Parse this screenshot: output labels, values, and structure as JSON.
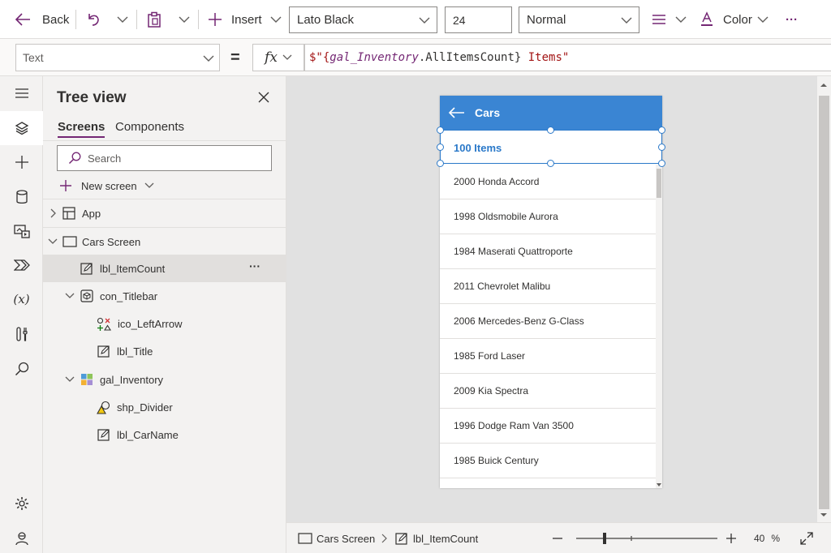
{
  "toolbar": {
    "back_label": "Back",
    "insert_label": "Insert",
    "font_value": "Lato Black",
    "size_value": "24",
    "weight_value": "Normal",
    "color_label": "Color",
    "more_label": "···"
  },
  "formula_bar": {
    "property_value": "Text",
    "equals": "=",
    "fx_label": "fx",
    "tokens": {
      "t1": "$\"{",
      "t2": "gal_Inventory",
      "t3": ".AllItemsCount} ",
      "t4": "Items\""
    }
  },
  "tree": {
    "title": "Tree view",
    "tabs": {
      "screens": "Screens",
      "components": "Components"
    },
    "search_placeholder": "Search",
    "new_screen_label": "New screen",
    "nodes": {
      "app": "App",
      "cars_screen": "Cars Screen",
      "lbl_itemcount": "lbl_ItemCount",
      "con_titlebar": "con_Titlebar",
      "ico_leftarrow": "ico_LeftArrow",
      "lbl_title": "lbl_Title",
      "gal_inventory": "gal_Inventory",
      "shp_divider": "shp_Divider",
      "lbl_carname": "lbl_CarName"
    },
    "row_more": "···"
  },
  "app_preview": {
    "title": "Cars",
    "item_count": "100 Items",
    "cars": [
      "2000 Honda Accord",
      "1998 Oldsmobile Aurora",
      "1984 Maserati Quattroporte",
      "2011 Chevrolet Malibu",
      "2006 Mercedes-Benz G-Class",
      "1985 Ford Laser",
      "2009 Kia Spectra",
      "1996 Dodge Ram Van 3500",
      "1985 Buick Century"
    ]
  },
  "status": {
    "screen_label": "Cars Screen",
    "control_label": "lbl_ItemCount",
    "zoom_value": "40",
    "zoom_unit": "%",
    "zoom_level": 0.4
  },
  "colors": {
    "accent": "#742774",
    "titlebar": "#3a85d3",
    "selection": "#2b79c9"
  },
  "icons": {
    "rail": [
      "hamburger-icon",
      "layers-icon",
      "plus-icon",
      "database-icon",
      "media-icon",
      "power-automate-icon",
      "variables-icon",
      "tools-icon",
      "search-icon",
      "settings-icon",
      "virtual-agent-icon"
    ]
  }
}
